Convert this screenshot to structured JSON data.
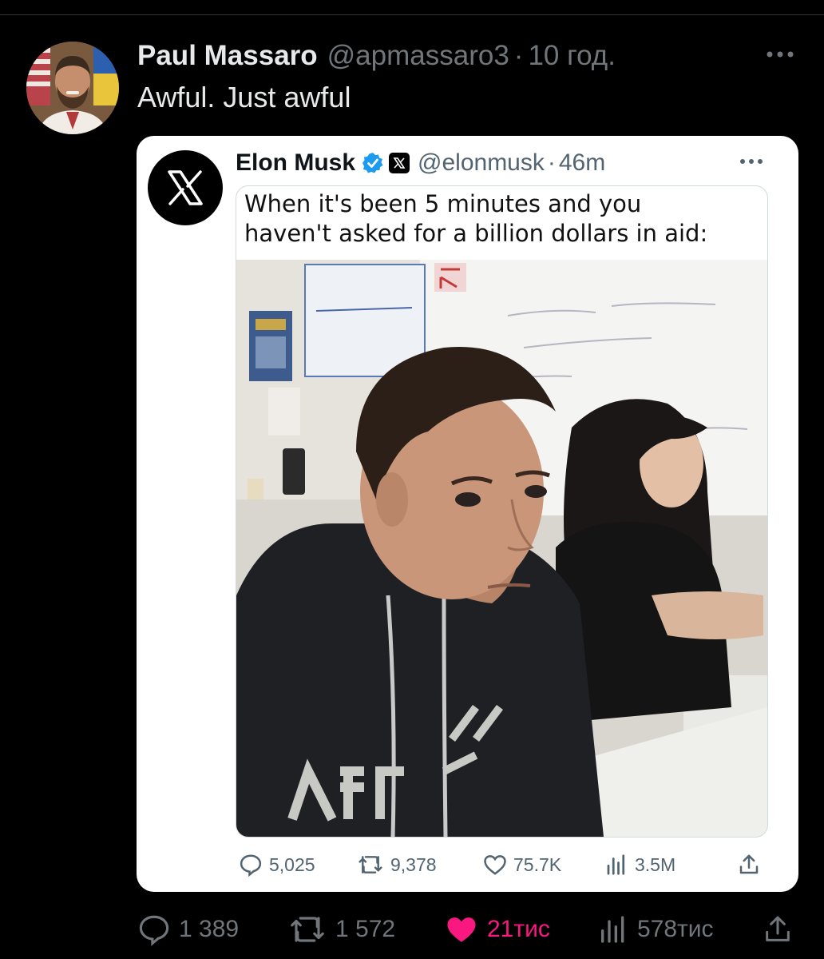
{
  "post": {
    "author_name": "Paul Massaro",
    "author_handle": "@apmassaro3",
    "separator": "·",
    "time": "10 год.",
    "text": "Awful. Just awful"
  },
  "quoted": {
    "author_name": "Elon Musk",
    "author_handle": "@elonmusk",
    "separator": "·",
    "time": "46m",
    "meme_caption_line1": "When it's been 5 minutes and you",
    "meme_caption_line2": "haven't asked for a billion dollars in aid:",
    "stats": {
      "replies": "5,025",
      "reposts": "9,378",
      "likes": "75.7K",
      "views": "3.5M"
    }
  },
  "actions": {
    "replies": "1 389",
    "reposts": "1 572",
    "likes": "21тис",
    "views": "578тис",
    "liked": true
  },
  "colors": {
    "background": "#000000",
    "text_primary": "#e7e9ea",
    "text_secondary": "#71767b",
    "like_active": "#f91880",
    "verified_blue": "#1d9bf0",
    "card_background": "#ffffff"
  },
  "icons": {
    "more": "more-horizontal-icon",
    "reply": "reply-icon",
    "repost": "repost-icon",
    "like": "heart-icon",
    "views": "views-bar-chart-icon",
    "share": "share-upload-icon",
    "verified": "verified-badge-icon",
    "x_logo": "x-logo-icon"
  }
}
